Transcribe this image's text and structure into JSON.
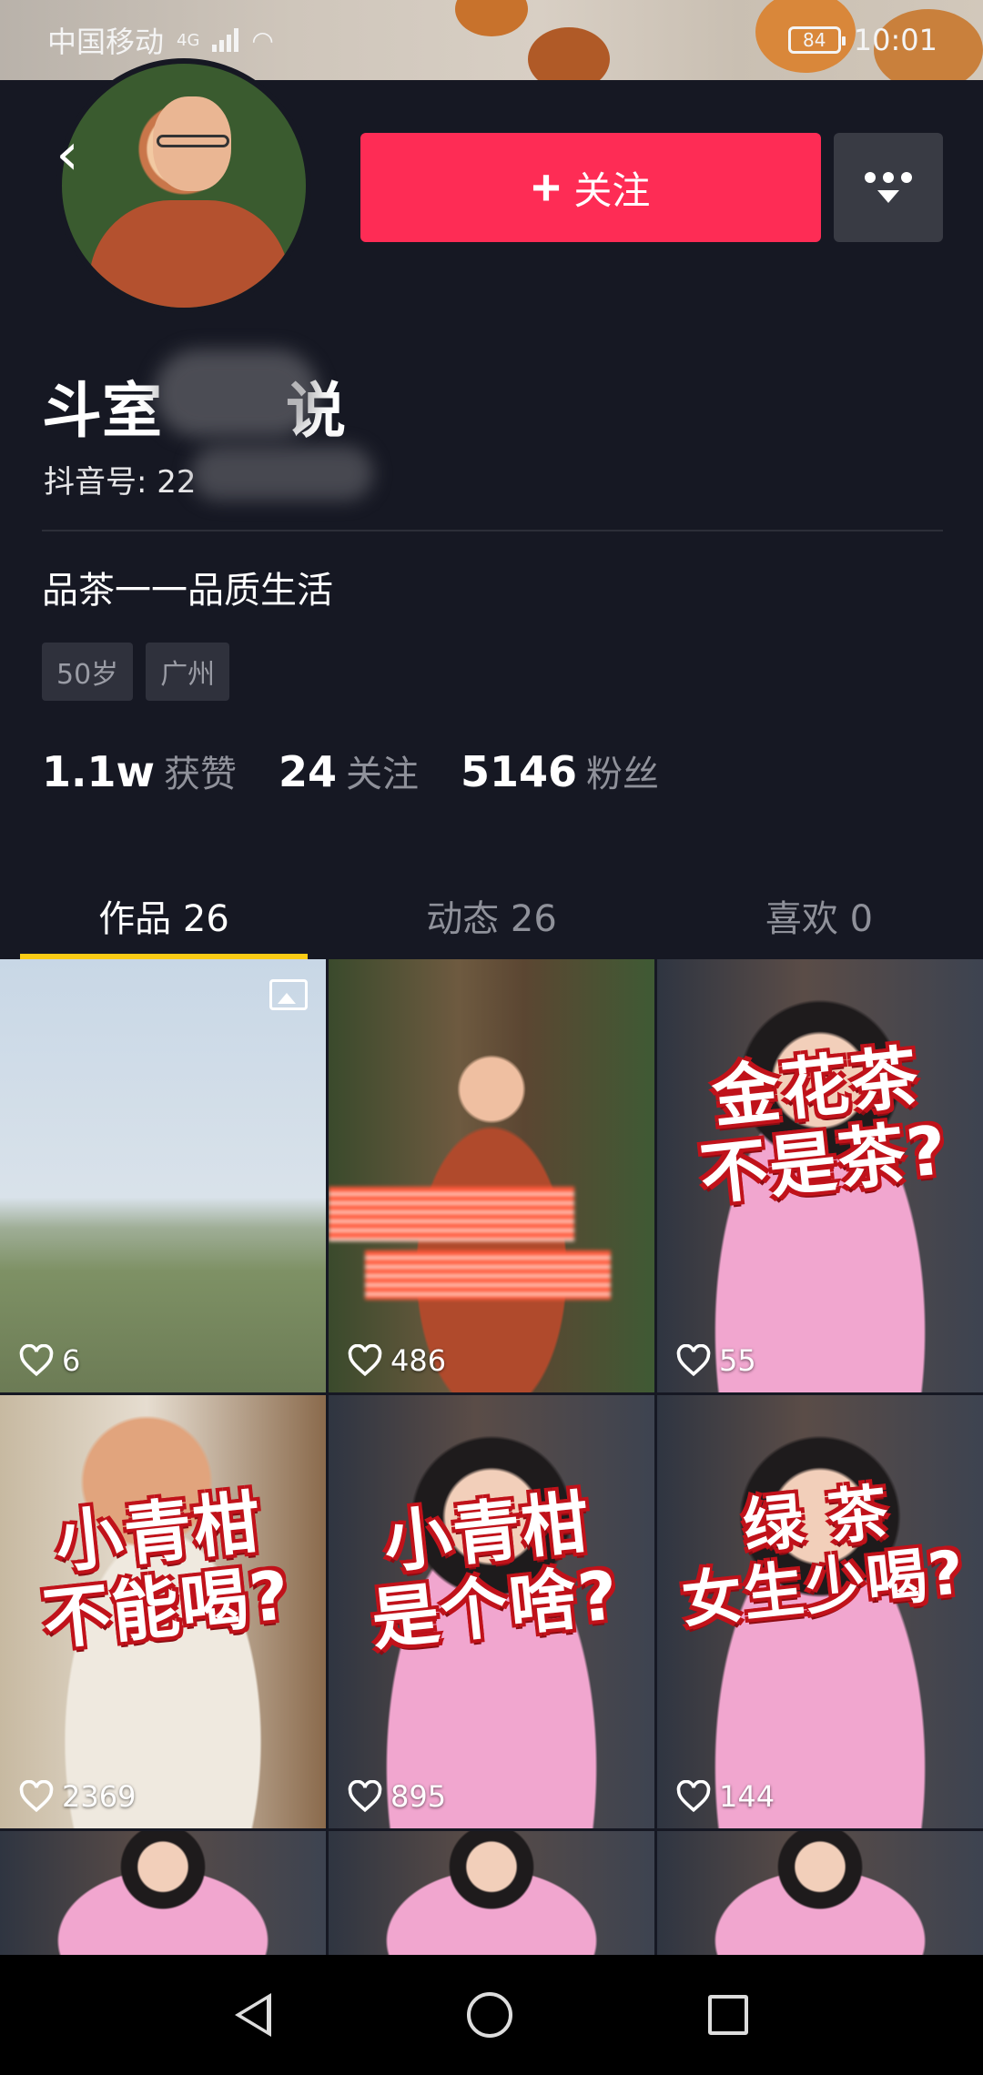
{
  "status_bar": {
    "carrier": "中国移动",
    "network": "4G",
    "battery": "84",
    "time": "10:01"
  },
  "header": {
    "back_icon": "chevron-left-icon",
    "follow_label": "关注",
    "follow_icon": "plus-icon",
    "more_icon": "more-dots-icon"
  },
  "profile": {
    "nickname_prefix": "斗室",
    "nickname_suffix": "说",
    "douyin_id": "抖音号: 22",
    "bio": "品茶一一品质生活",
    "tags": [
      "50岁",
      "广州"
    ],
    "stats": [
      {
        "value": "1.1w",
        "label": "获赞"
      },
      {
        "value": "24",
        "label": "关注"
      },
      {
        "value": "5146",
        "label": "粉丝"
      }
    ]
  },
  "tabs": [
    {
      "label": "作品 26",
      "active": true
    },
    {
      "label": "动态 26",
      "active": false
    },
    {
      "label": "喜欢 0",
      "active": false
    }
  ],
  "videos": [
    {
      "likes": "6",
      "overlay": "",
      "style": "landscape",
      "has_image_icon": true
    },
    {
      "likes": "486",
      "overlay": "",
      "style": "studio",
      "has_image_icon": false
    },
    {
      "likes": "55",
      "overlay": "金花茶\n不是茶?",
      "style": "girl",
      "has_image_icon": false
    },
    {
      "likes": "2369",
      "overlay": "小青柑\n不能喝?",
      "style": "man",
      "has_image_icon": false
    },
    {
      "likes": "895",
      "overlay": "小青柑\n是个啥?",
      "style": "girl",
      "has_image_icon": false
    },
    {
      "likes": "144",
      "overlay": "绿 茶\n女生少喝?",
      "style": "girl",
      "has_image_icon": false
    }
  ],
  "colors": {
    "background": "#161823",
    "follow": "#fe2c55",
    "tab_indicator": "#facc15"
  }
}
